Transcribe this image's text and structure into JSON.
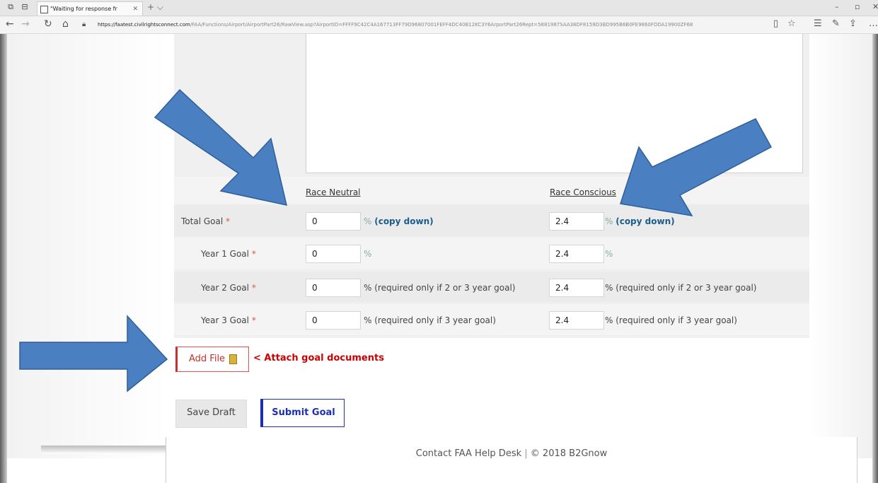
{
  "browser": {
    "tab_title": "\"Waiting for response fr",
    "url_host": "https://faatest.civilrightsconnect.com",
    "url_path": "/FAA/Functions/Airport/AirportPart26/RawView.asp?AirportID=FFFF9C42C4A167713FF79D96807001FEFF4DC40B12KC3Y6ArportPart26Rept=5881987SAA38DF8159D3BD995B6B0FE9860FDDA19900ZF68"
  },
  "form": {
    "col_neutral": "Race Neutral",
    "col_conscious": "Race Conscious",
    "rows": [
      {
        "label": "Total Goal",
        "neutral_value": "0",
        "neutral_suffix": "% ",
        "neutral_link": "(copy down)",
        "conscious_value": "2.4",
        "conscious_suffix": "% ",
        "conscious_link": "(copy down)"
      },
      {
        "label": "Year 1 Goal",
        "neutral_value": "0",
        "neutral_suffix": "%",
        "conscious_value": "2.4",
        "conscious_suffix": "%"
      },
      {
        "label": "Year 2 Goal",
        "neutral_value": "0",
        "neutral_suffix": "% (required only if 2 or 3 year goal)",
        "conscious_value": "2.4",
        "conscious_suffix": "% (required only if 2 or 3 year goal)"
      },
      {
        "label": "Year 3 Goal",
        "neutral_value": "0",
        "neutral_suffix": "% (required only if 3 year goal)",
        "conscious_value": "2.4",
        "conscious_suffix": "% (required only if 3 year goal)"
      }
    ],
    "required_mark": "*"
  },
  "actions": {
    "add_file": "Add File",
    "attach_note": "< Attach goal documents",
    "save_draft": "Save Draft",
    "submit_goal": "Submit Goal"
  },
  "footer": {
    "help": "Contact FAA Help Desk",
    "sep": "|",
    "copyright": "© 2018 B2Gnow"
  },
  "colors": {
    "arrow": "#4a7fc1",
    "required": "#d9534f",
    "submit": "#1d2fb2",
    "attach": "#cc0000"
  }
}
